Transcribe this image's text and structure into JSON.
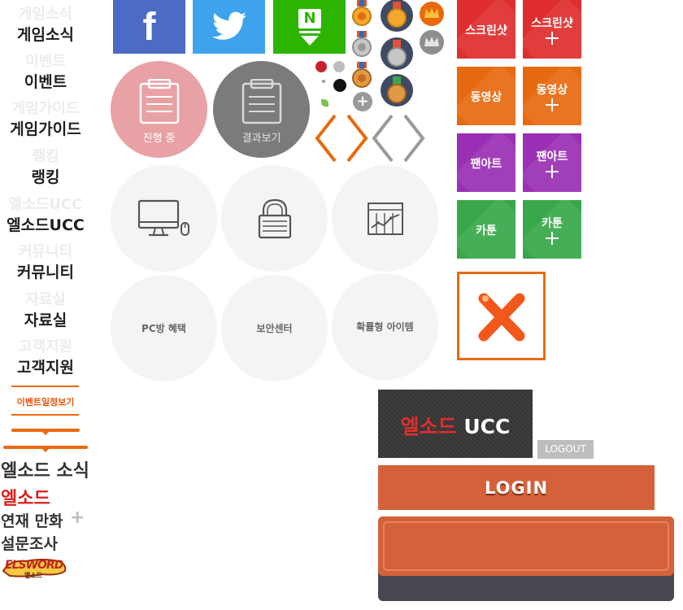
{
  "nav": {
    "items": [
      {
        "ghost": "게임소식",
        "label": "게임소식"
      },
      {
        "ghost": "이벤트",
        "label": "이벤트"
      },
      {
        "ghost": "게임가이드",
        "label": "게임가이드"
      },
      {
        "ghost": "랭킹",
        "label": "랭킹"
      },
      {
        "ghost": "엘소드UCC",
        "label": "엘소드UCC"
      },
      {
        "ghost": "커뮤니티",
        "label": "커뮤니티"
      },
      {
        "ghost": "자료실",
        "label": "자료실"
      },
      {
        "ghost": "고객지원",
        "label": "고객지원"
      }
    ],
    "event_schedule": "이벤트일정보기"
  },
  "sidebar_bottom": {
    "news_title": "엘소드 소식",
    "brand_red": "엘소드",
    "serial_comic": "연재 만화",
    "serial_plus": "+",
    "survey": "설문조사",
    "logo_text": "ELSWORD",
    "logo_sub": "엘소드"
  },
  "social": {
    "facebook": "f",
    "naver": "N"
  },
  "status_circles": {
    "in_progress": "진행 중",
    "results": "결과보기"
  },
  "service_circles": {
    "pc_bang": "PC방 혜택",
    "security": "보안센터",
    "probability": "확률형 아이템"
  },
  "tiles": {
    "screenshot": "스크린샷",
    "video": "동영상",
    "fanart": "팬아트",
    "cartoon": "카툰"
  },
  "ucc_banner": {
    "red": "엘소드",
    "white": "UCC"
  },
  "logout_label": "LOGOUT",
  "login_label": "LOGIN",
  "misc": {
    "plus_glyph": "+"
  },
  "colors": {
    "facebook": "#4c6bc4",
    "twitter": "#3ea3ec",
    "naver": "#2db400",
    "pink": "#e8a1a4",
    "gray": "#7a7b7d",
    "screenshot": "#e02d2d",
    "video": "#e86a10",
    "fanart": "#9a2fb5",
    "cartoon": "#38a84a",
    "login": "#d4613a"
  }
}
